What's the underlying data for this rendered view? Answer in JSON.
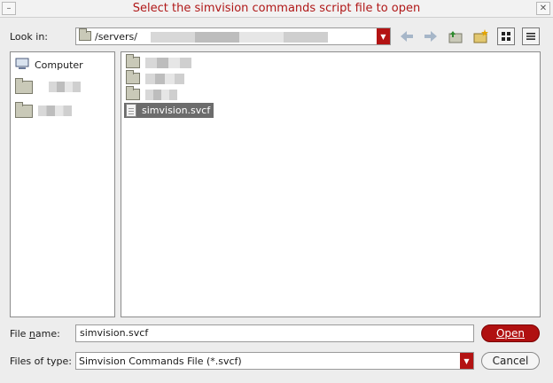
{
  "window": {
    "title": "Select the simvision commands script file to open",
    "minimize_glyph": "–",
    "close_glyph": "✕"
  },
  "toolbar": {
    "look_in_label": "Look in:",
    "path": "/servers/",
    "icons": [
      "back-icon",
      "forward-icon",
      "up-folder-icon",
      "new-folder-icon",
      "icon-view-icon",
      "list-view-icon"
    ]
  },
  "places": {
    "computer_label": "Computer"
  },
  "files": {
    "selected_file": "simvision.svcf"
  },
  "form": {
    "file_name_label_pre": "File ",
    "file_name_label_u": "n",
    "file_name_label_post": "ame:",
    "file_name_value": "simvision.svcf",
    "files_of_type_label": "Files of type:",
    "files_of_type_value": "Simvision Commands File (*.svcf)"
  },
  "buttons": {
    "open_label": "Open",
    "cancel_label": "Cancel"
  },
  "colors": {
    "accent": "#b01010",
    "title_text": "#b01818",
    "selection": "#6c6c6c"
  }
}
